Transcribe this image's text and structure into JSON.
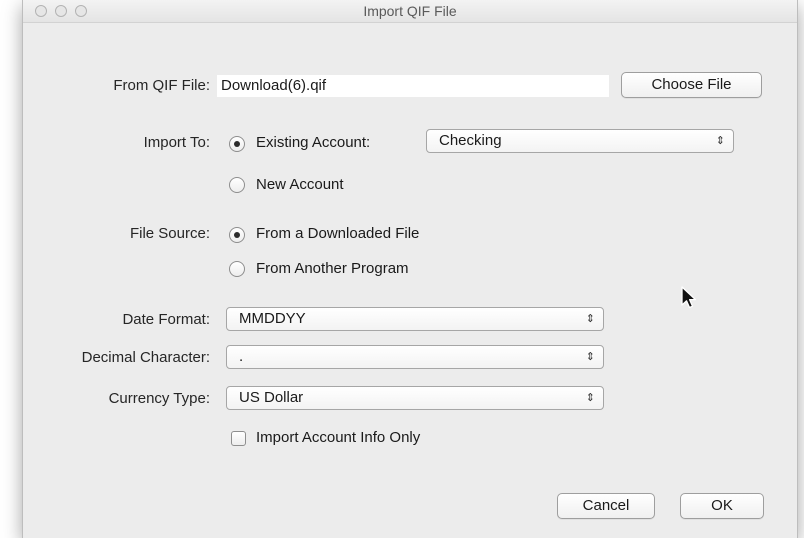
{
  "window": {
    "title": "Import QIF File"
  },
  "from_qif": {
    "label": "From QIF File:",
    "value": "Download(6).qif",
    "choose_label": "Choose File"
  },
  "import_to": {
    "label": "Import To:",
    "existing_label": "Existing Account:",
    "existing_selected": true,
    "account_select": "Checking",
    "new_label": "New Account"
  },
  "file_source": {
    "label": "File Source:",
    "downloaded_label": "From a Downloaded File",
    "downloaded_selected": true,
    "other_label": "From Another Program"
  },
  "date_format": {
    "label": "Date Format:",
    "value": "MMDDYY"
  },
  "decimal_char": {
    "label": "Decimal Character:",
    "value": "."
  },
  "currency_type": {
    "label": "Currency Type:",
    "value": "US Dollar"
  },
  "account_info_only": {
    "label": "Import Account Info Only",
    "checked": false
  },
  "buttons": {
    "cancel": "Cancel",
    "ok": "OK"
  },
  "icons": {
    "select_arrows": "⇕",
    "cursor": "mouse-pointer-icon"
  }
}
